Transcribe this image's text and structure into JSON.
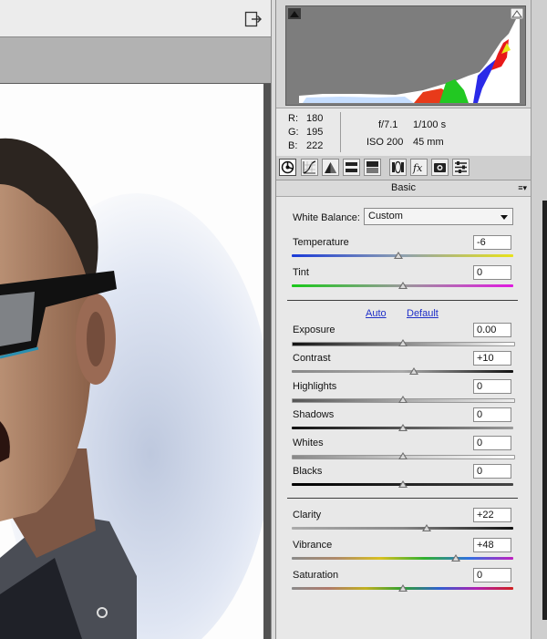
{
  "histogram": {
    "readout": {
      "r_label": "R:",
      "r_value": "180",
      "g_label": "G:",
      "g_value": "195",
      "b_label": "B:",
      "b_value": "222"
    },
    "camera": {
      "aperture": "f/7.1",
      "shutter": "1/100 s",
      "iso": "ISO 200",
      "focal_length": "45 mm"
    }
  },
  "tool_tabs": [
    "basic-icon",
    "tone-curve-icon",
    "detail-icon",
    "hsl-icon",
    "split-toning-icon",
    "lens-corrections-icon",
    "effects-icon",
    "camera-calibration-icon",
    "presets-icon"
  ],
  "panel": {
    "title": "Basic",
    "menu_glyph": "≡▾",
    "white_balance": {
      "label": "White Balance:",
      "value": "Custom"
    },
    "auto_label": "Auto",
    "default_label": "Default",
    "sliders": [
      {
        "label": "Temperature",
        "value": "-6",
        "fraction": 0.48
      },
      {
        "label": "Tint",
        "value": "0",
        "fraction": 0.5
      },
      {
        "label": "Exposure",
        "value": "0.00",
        "fraction": 0.5
      },
      {
        "label": "Contrast",
        "value": "+10",
        "fraction": 0.55
      },
      {
        "label": "Highlights",
        "value": "0",
        "fraction": 0.5
      },
      {
        "label": "Shadows",
        "value": "0",
        "fraction": 0.5
      },
      {
        "label": "Whites",
        "value": "0",
        "fraction": 0.5
      },
      {
        "label": "Blacks",
        "value": "0",
        "fraction": 0.5
      },
      {
        "label": "Clarity",
        "value": "+22",
        "fraction": 0.61
      },
      {
        "label": "Vibrance",
        "value": "+48",
        "fraction": 0.74
      },
      {
        "label": "Saturation",
        "value": "0",
        "fraction": 0.5
      }
    ]
  },
  "colors": {
    "link": "#2030c8",
    "panel_bg": "#e8e8e8",
    "histogram_bg": "#7d7d7d"
  }
}
